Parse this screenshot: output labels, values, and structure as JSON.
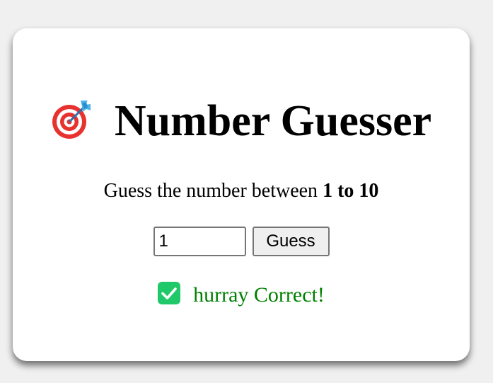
{
  "header": {
    "title": "Number Guesser",
    "title_icon": "dart-target-icon"
  },
  "prompt": {
    "text": "Guess the number between ",
    "range_text": "1 to 10"
  },
  "form": {
    "input_value": "1",
    "button_label": "Guess"
  },
  "result": {
    "icon": "check-mark-icon",
    "text": "hurray Correct!",
    "color": "#008000"
  },
  "colors": {
    "page_background": "#f0f0f0",
    "card_background": "#ffffff",
    "check_badge": "#1fc96a",
    "target_red": "#e8322f",
    "dart_blue": "#4bb4e8"
  }
}
